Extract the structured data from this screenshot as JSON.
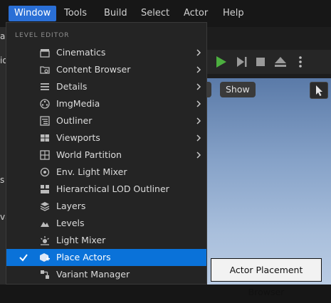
{
  "menubar": {
    "items": [
      {
        "label": "Window",
        "active": true
      },
      {
        "label": "Tools"
      },
      {
        "label": "Build"
      },
      {
        "label": "Select"
      },
      {
        "label": "Actor"
      },
      {
        "label": "Help"
      }
    ]
  },
  "background": {
    "left_fragments": [
      "all",
      "io",
      "s",
      "var"
    ],
    "show_button": "Show",
    "tooltip": "Actor Placement Browser"
  },
  "menu": {
    "section_label": "LEVEL EDITOR",
    "items": [
      {
        "label": "Cinematics",
        "icon": "clapperboard-icon",
        "submenu": true
      },
      {
        "label": "Content Browser",
        "icon": "content-browser-icon",
        "submenu": true
      },
      {
        "label": "Details",
        "icon": "details-list-icon",
        "submenu": true
      },
      {
        "label": "ImgMedia",
        "icon": "film-reel-icon",
        "submenu": true
      },
      {
        "label": "Outliner",
        "icon": "outliner-icon",
        "submenu": true
      },
      {
        "label": "Viewports",
        "icon": "viewports-icon",
        "submenu": true
      },
      {
        "label": "World Partition",
        "icon": "world-partition-icon",
        "submenu": true
      },
      {
        "label": "Env. Light Mixer",
        "icon": "light-mixer-icon",
        "submenu": false
      },
      {
        "label": "Hierarchical LOD Outliner",
        "icon": "hlod-icon",
        "submenu": false
      },
      {
        "label": "Layers",
        "icon": "layers-icon",
        "submenu": false
      },
      {
        "label": "Levels",
        "icon": "levels-icon",
        "submenu": false
      },
      {
        "label": "Light Mixer",
        "icon": "light-icon",
        "submenu": false
      },
      {
        "label": "Place Actors",
        "icon": "place-actors-icon",
        "submenu": false,
        "checked": true,
        "selected": true
      },
      {
        "label": "Variant Manager",
        "icon": "variant-manager-icon",
        "submenu": false
      }
    ]
  },
  "colors": {
    "accent": "#0a72d9",
    "menu_bg": "#242424",
    "play_green": "#4caf3f"
  }
}
